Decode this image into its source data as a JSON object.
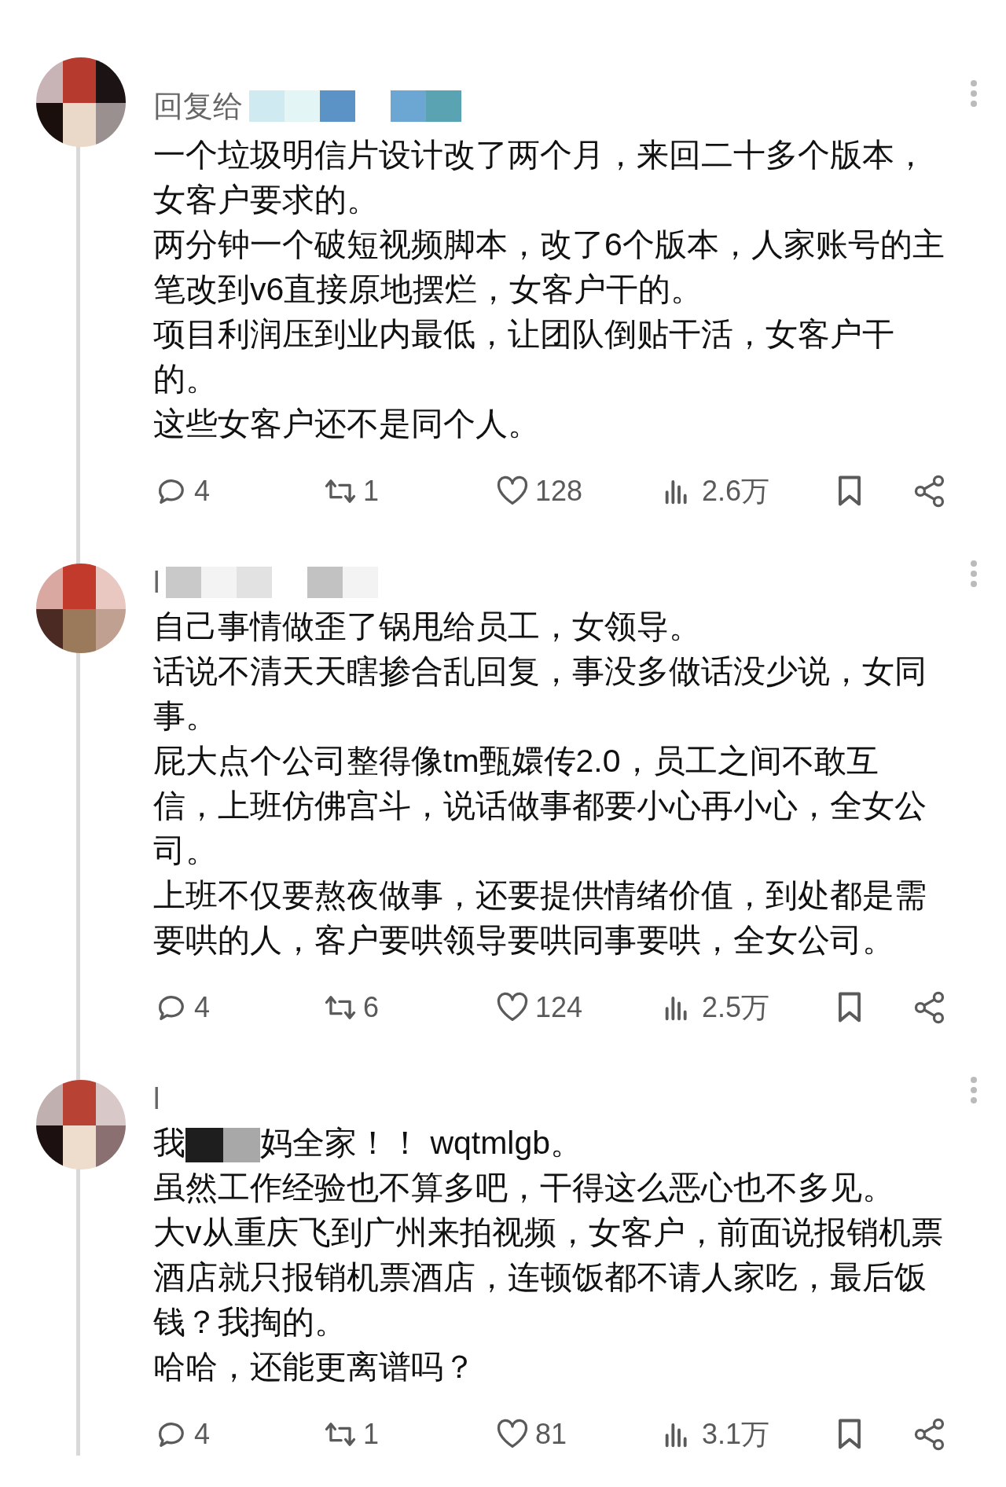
{
  "comments": [
    {
      "header": {
        "text": "回复给",
        "redacted": true
      },
      "paragraphs": [
        {
          "kind": "text",
          "lines": [
            "一个垃圾明信片设计改了两个月，来回二十多个版本，",
            "女客户要求的。"
          ]
        },
        {
          "kind": "text",
          "lines": [
            "两分钟一个破短视频脚本，改了6个版本，人家账号的主",
            "笔改到v6直接原地摆烂，女客户干的。"
          ]
        },
        {
          "kind": "text",
          "lines": [
            "项目利润压到业内最低，让团队倒贴干活，女客户干",
            "的。"
          ]
        },
        {
          "kind": "text",
          "lines": [
            "这些女客户还不是同个人。"
          ]
        }
      ],
      "actions": {
        "replies": "4",
        "reposts": "1",
        "likes": "128",
        "views": "2.6万"
      }
    },
    {
      "header": {
        "text": "l",
        "redacted": true
      },
      "paragraphs": [
        {
          "kind": "text",
          "lines": [
            "自己事情做歪了锅甩给员工，女领导。"
          ]
        },
        {
          "kind": "text",
          "lines": [
            "话说不清天天瞎掺合乱回复，事没多做话没少说，女同",
            "事。"
          ]
        },
        {
          "kind": "text",
          "lines": [
            "屁大点个公司整得像tm甄嬛传2.0，员工之间不敢互",
            "信，上班仿佛宫斗，说话做事都要小心再小心，全女公",
            "司。"
          ]
        },
        {
          "kind": "text",
          "lines": [
            "上班不仅要熬夜做事，还要提供情绪价值，到处都是需",
            "要哄的人，客户要哄领导要哄同事要哄，全女公司。"
          ]
        }
      ],
      "actions": {
        "replies": "4",
        "reposts": "6",
        "likes": "124",
        "views": "2.5万"
      }
    },
    {
      "header": {
        "text": "l",
        "redacted": false
      },
      "paragraphs": [
        {
          "kind": "redacted",
          "before": "我",
          "after": "妈全家！！ wqtmlgb。"
        },
        {
          "kind": "text",
          "lines": [
            "虽然工作经验也不算多吧，干得这么恶心也不多见。"
          ]
        },
        {
          "kind": "text",
          "lines": [
            "大v从重庆飞到广州来拍视频，女客户，前面说报销机票",
            "酒店就只报销机票酒店，连顿饭都不请人家吃，最后饭",
            "钱？我掏的。"
          ]
        },
        {
          "kind": "text",
          "lines": [
            "哈哈，还能更离谱吗？"
          ]
        }
      ],
      "actions": {
        "replies": "4",
        "reposts": "1",
        "likes": "81",
        "views": "3.1万"
      }
    }
  ]
}
